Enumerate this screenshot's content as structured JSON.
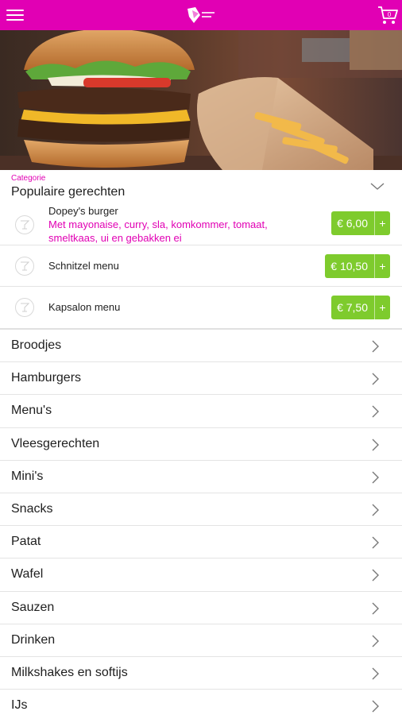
{
  "app": {
    "brand_color": "#e100b4",
    "accent_green": "#7ecb2d"
  },
  "header": {
    "menu_icon": "hamburger-menu-icon",
    "logo_icon": "brand-logo-icon",
    "cart_icon": "shopping-cart-icon",
    "cart_count": "0"
  },
  "hero": {
    "image": "burger-and-fries-photo"
  },
  "category": {
    "label": "Categorie",
    "title": "Populaire gerechten",
    "toggle_icon": "chevron-down-icon"
  },
  "popular": {
    "items": [
      {
        "name": "Dopey's burger",
        "description": "Met mayonaise, curry, sla, komkommer, tomaat, smeltkaas, ui en gebakken ei",
        "price": "€ 6,00",
        "add": "+"
      },
      {
        "name": "Schnitzel menu",
        "description": "",
        "price": "€ 10,50",
        "add": "+"
      },
      {
        "name": "Kapsalon menu",
        "description": "",
        "price": "€ 7,50",
        "add": "+"
      }
    ]
  },
  "categories": [
    "Broodjes",
    "Hamburgers",
    "Menu's",
    "Vleesgerechten",
    "Mini's",
    "Snacks",
    "Patat",
    "Wafel",
    "Sauzen",
    "Drinken",
    "Milkshakes en softijs",
    "IJs"
  ]
}
